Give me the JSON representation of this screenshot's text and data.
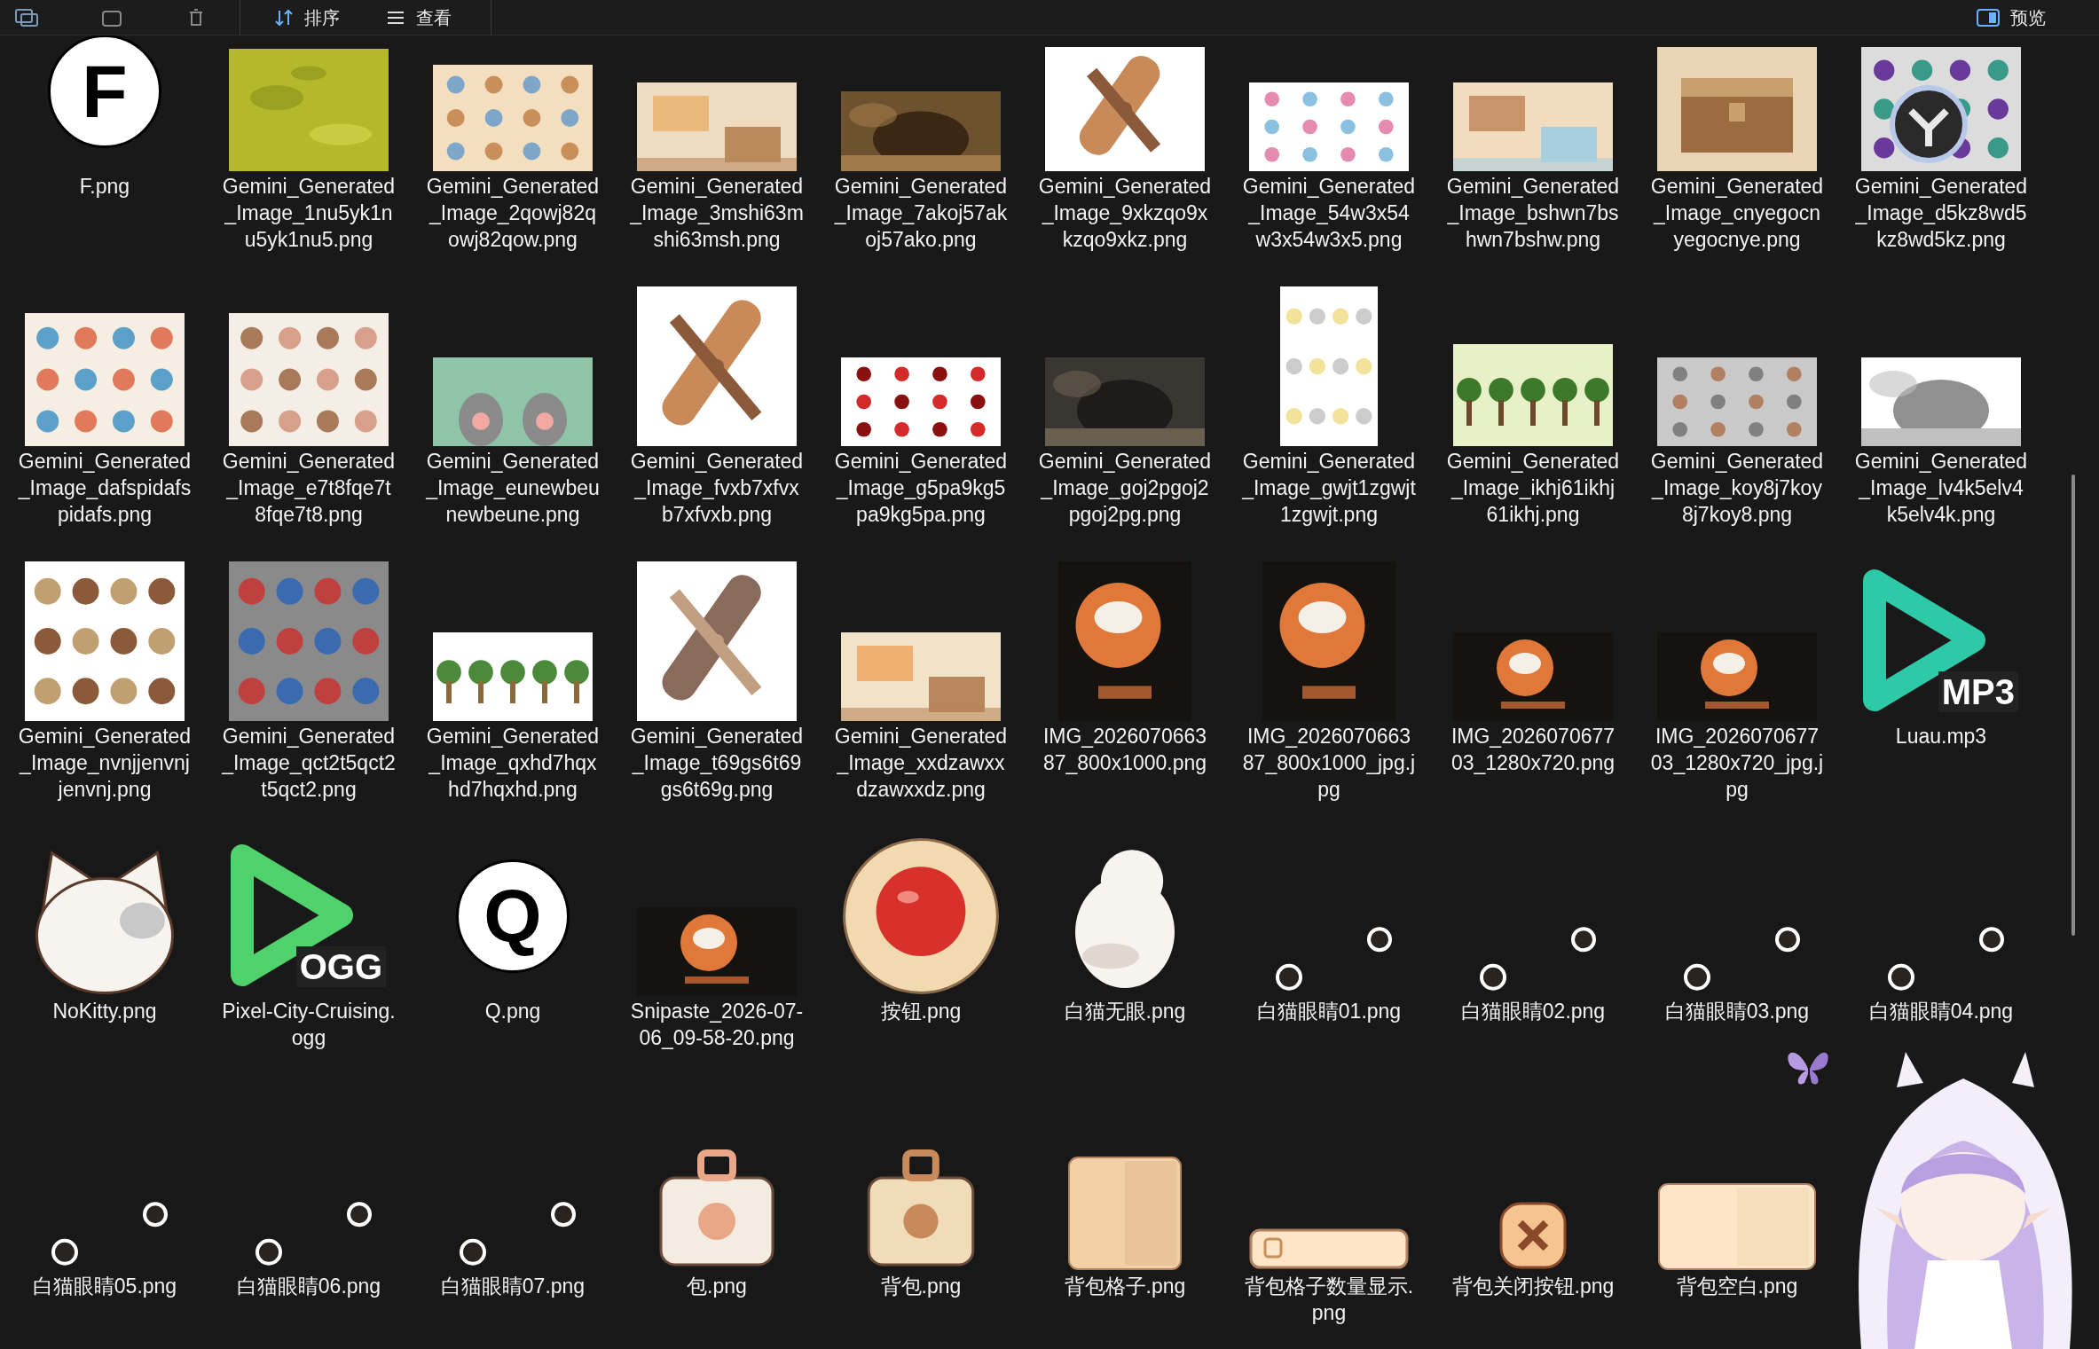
{
  "toolbar": {
    "actions": [
      {
        "label": "排序",
        "kind": "sort"
      },
      {
        "label": "查看",
        "kind": "view"
      }
    ],
    "preview": {
      "label": "预览"
    }
  },
  "files": [
    {
      "name": "F.png",
      "kind": "letter",
      "glyph": "F"
    },
    {
      "name": "Gemini_Generated_Image_1nu5yk1nu5yk1nu5.png",
      "kind": "picture"
    },
    {
      "name": "Gemini_Generated_Image_2qowj82qowj82qow.png",
      "kind": "picture"
    },
    {
      "name": "Gemini_Generated_Image_3mshi63mshi63msh.png",
      "kind": "picture"
    },
    {
      "name": "Gemini_Generated_Image_7akoj57akoj57ako.png",
      "kind": "picture"
    },
    {
      "name": "Gemini_Generated_Image_9xkzqo9xkzqo9xkz.png",
      "kind": "picture"
    },
    {
      "name": "Gemini_Generated_Image_54w3x54w3x54w3x5.png",
      "kind": "picture"
    },
    {
      "name": "Gemini_Generated_Image_bshwn7bshwn7bshw.png",
      "kind": "picture"
    },
    {
      "name": "Gemini_Generated_Image_cnyegocnyegocnye.png",
      "kind": "picture"
    },
    {
      "name": "Gemini_Generated_Image_d5kz8wd5kz8wd5kz.png",
      "kind": "picture"
    },
    {
      "name": "Gemini_Generated_Image_dafspidafspidafs.png",
      "kind": "picture"
    },
    {
      "name": "Gemini_Generated_Image_e7t8fqe7t8fqe7t8.png",
      "kind": "picture"
    },
    {
      "name": "Gemini_Generated_Image_eunewbeunewbeune.png",
      "kind": "picture"
    },
    {
      "name": "Gemini_Generated_Image_fvxb7xfvxb7xfvxb.png",
      "kind": "picture"
    },
    {
      "name": "Gemini_Generated_Image_g5pa9kg5pa9kg5pa.png",
      "kind": "picture"
    },
    {
      "name": "Gemini_Generated_Image_goj2pgoj2pgoj2pg.png",
      "kind": "picture"
    },
    {
      "name": "Gemini_Generated_Image_gwjt1zgwjt1zgwjt.png",
      "kind": "picture"
    },
    {
      "name": "Gemini_Generated_Image_ikhj61ikhj61ikhj.png",
      "kind": "picture"
    },
    {
      "name": "Gemini_Generated_Image_koy8j7koy8j7koy8.png",
      "kind": "picture"
    },
    {
      "name": "Gemini_Generated_Image_lv4k5elv4k5elv4k.png",
      "kind": "picture"
    },
    {
      "name": "Gemini_Generated_Image_nvnjjenvnjjenvnj.png",
      "kind": "picture"
    },
    {
      "name": "Gemini_Generated_Image_qct2t5qct2t5qct2.png",
      "kind": "picture"
    },
    {
      "name": "Gemini_Generated_Image_qxhd7hqxhd7hqxhd.png",
      "kind": "picture"
    },
    {
      "name": "Gemini_Generated_Image_t69gs6t69gs6t69g.png",
      "kind": "picture"
    },
    {
      "name": "Gemini_Generated_Image_xxdzawxxdzawxxdz.png",
      "kind": "picture"
    },
    {
      "name": "IMG_202607066387_800x1000.png",
      "kind": "picture"
    },
    {
      "name": "IMG_202607066387_800x1000_jpg.jpg",
      "kind": "picture"
    },
    {
      "name": "IMG_202607067703_1280x720.png",
      "kind": "picture"
    },
    {
      "name": "IMG_202607067703_1280x720_jpg.jpg",
      "kind": "picture"
    },
    {
      "name": "Luau.mp3",
      "kind": "audio",
      "badge": "MP3",
      "color": "#2ec9a7"
    },
    {
      "name": "NoKitty.png",
      "kind": "picture"
    },
    {
      "name": "Pixel-City-Cruising.ogg",
      "kind": "audio",
      "badge": "OGG",
      "color": "#4fd16b"
    },
    {
      "name": "Q.png",
      "kind": "letter",
      "glyph": "Q"
    },
    {
      "name": "Snipaste_2026-07-06_09-58-20.png",
      "kind": "picture"
    },
    {
      "name": "按钮.png",
      "kind": "picture"
    },
    {
      "name": "白猫无眼.png",
      "kind": "picture"
    },
    {
      "name": "白猫眼睛01.png",
      "kind": "picture"
    },
    {
      "name": "白猫眼睛02.png",
      "kind": "picture"
    },
    {
      "name": "白猫眼睛03.png",
      "kind": "picture"
    },
    {
      "name": "白猫眼睛04.png",
      "kind": "picture"
    },
    {
      "name": "白猫眼睛05.png",
      "kind": "picture"
    },
    {
      "name": "白猫眼睛06.png",
      "kind": "picture"
    },
    {
      "name": "白猫眼睛07.png",
      "kind": "picture"
    },
    {
      "name": "包.png",
      "kind": "picture"
    },
    {
      "name": "背包.png",
      "kind": "picture"
    },
    {
      "name": "背包格子.png",
      "kind": "picture"
    },
    {
      "name": "背包格子数量显示.png",
      "kind": "picture"
    },
    {
      "name": "背包关闭按钮.png",
      "kind": "picture"
    },
    {
      "name": "背包空白.png",
      "kind": "picture"
    }
  ]
}
